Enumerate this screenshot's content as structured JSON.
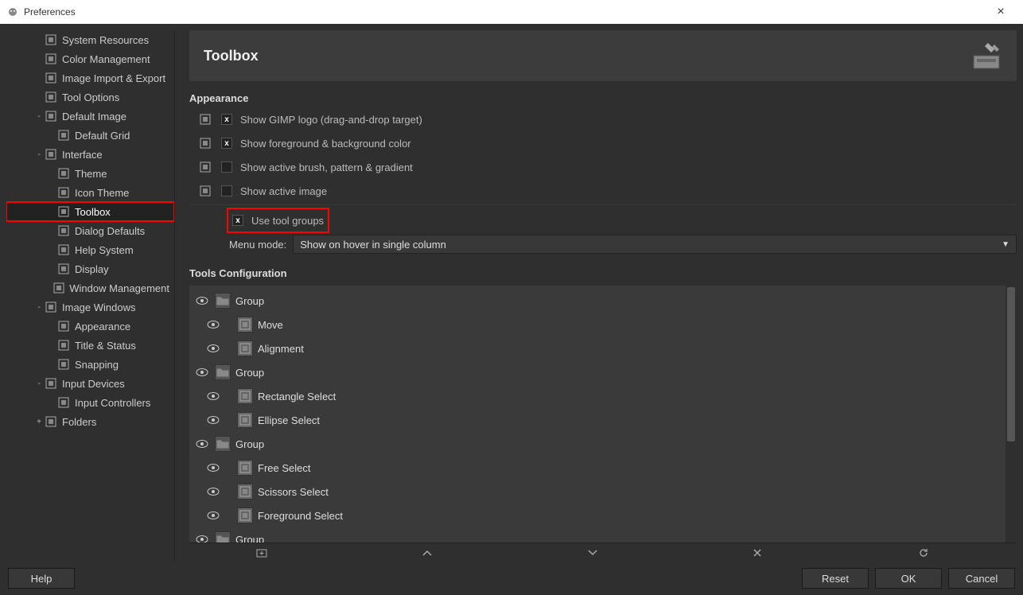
{
  "window": {
    "title": "Preferences"
  },
  "sidebar": {
    "items": [
      {
        "label": "System Resources",
        "indent": 1,
        "exp": "",
        "icon": "chip-icon"
      },
      {
        "label": "Color Management",
        "indent": 1,
        "exp": "",
        "icon": "color-mgmt-icon"
      },
      {
        "label": "Image Import & Export",
        "indent": 1,
        "exp": "",
        "icon": "import-export-icon"
      },
      {
        "label": "Tool Options",
        "indent": 1,
        "exp": "",
        "icon": "tool-options-icon"
      },
      {
        "label": "Default Image",
        "indent": 1,
        "exp": "-",
        "icon": "default-image-icon"
      },
      {
        "label": "Default Grid",
        "indent": 2,
        "exp": "",
        "icon": "grid-icon"
      },
      {
        "label": "Interface",
        "indent": 1,
        "exp": "-",
        "icon": "interface-icon"
      },
      {
        "label": "Theme",
        "indent": 2,
        "exp": "",
        "icon": "theme-icon"
      },
      {
        "label": "Icon Theme",
        "indent": 2,
        "exp": "",
        "icon": "icon-theme-icon"
      },
      {
        "label": "Toolbox",
        "indent": 2,
        "exp": "",
        "icon": "toolbox-tree-icon",
        "selected": true,
        "highlighted": true
      },
      {
        "label": "Dialog Defaults",
        "indent": 2,
        "exp": "",
        "icon": "dialog-defaults-icon"
      },
      {
        "label": "Help System",
        "indent": 2,
        "exp": "",
        "icon": "help-system-icon"
      },
      {
        "label": "Display",
        "indent": 2,
        "exp": "",
        "icon": "display-icon"
      },
      {
        "label": "Window Management",
        "indent": 2,
        "exp": "",
        "icon": "window-mgmt-icon"
      },
      {
        "label": "Image Windows",
        "indent": 1,
        "exp": "-",
        "icon": "image-windows-icon"
      },
      {
        "label": "Appearance",
        "indent": 2,
        "exp": "",
        "icon": "appearance-icon"
      },
      {
        "label": "Title & Status",
        "indent": 2,
        "exp": "",
        "icon": "title-status-icon"
      },
      {
        "label": "Snapping",
        "indent": 2,
        "exp": "",
        "icon": "snapping-icon"
      },
      {
        "label": "Input Devices",
        "indent": 1,
        "exp": "-",
        "icon": "input-devices-icon"
      },
      {
        "label": "Input Controllers",
        "indent": 2,
        "exp": "",
        "icon": "input-controllers-icon"
      },
      {
        "label": "Folders",
        "indent": 1,
        "exp": "+",
        "icon": "folders-icon"
      }
    ]
  },
  "header": {
    "title": "Toolbox"
  },
  "appearance": {
    "title": "Appearance",
    "options": [
      {
        "label": "Show GIMP logo (drag-and-drop target)",
        "checked": true,
        "icon": "gimp-logo-icon"
      },
      {
        "label": "Show foreground & background color",
        "checked": true,
        "icon": "fgbg-icon"
      },
      {
        "label": "Show active brush, pattern & gradient",
        "checked": false,
        "icon": "brush-icon"
      },
      {
        "label": "Show active image",
        "checked": false,
        "icon": "active-image-icon"
      }
    ],
    "tool_groups": {
      "label": "Use tool groups",
      "checked": true
    },
    "menu_mode": {
      "label": "Menu mode:",
      "value": "Show on hover in single column"
    }
  },
  "tools_config": {
    "title": "Tools Configuration",
    "rows": [
      {
        "type": "group",
        "label": "Group",
        "visible": true
      },
      {
        "type": "tool",
        "label": "Move",
        "visible": true,
        "icon": "move-tool-icon"
      },
      {
        "type": "tool",
        "label": "Alignment",
        "visible": true,
        "icon": "alignment-tool-icon"
      },
      {
        "type": "group",
        "label": "Group",
        "visible": true
      },
      {
        "type": "tool",
        "label": "Rectangle Select",
        "visible": true,
        "icon": "rect-select-icon"
      },
      {
        "type": "tool",
        "label": "Ellipse Select",
        "visible": true,
        "icon": "ellipse-select-icon"
      },
      {
        "type": "group",
        "label": "Group",
        "visible": true
      },
      {
        "type": "tool",
        "label": "Free Select",
        "visible": true,
        "icon": "free-select-icon"
      },
      {
        "type": "tool",
        "label": "Scissors Select",
        "visible": true,
        "icon": "scissors-select-icon"
      },
      {
        "type": "tool",
        "label": "Foreground Select",
        "visible": true,
        "icon": "foreground-select-icon"
      },
      {
        "type": "group",
        "label": "Group",
        "visible": true
      }
    ],
    "toolbar": {
      "add": "add",
      "up": "up",
      "down": "down",
      "delete": "delete",
      "reset": "reset"
    }
  },
  "footer": {
    "help": "Help",
    "reset": "Reset",
    "ok": "OK",
    "cancel": "Cancel"
  }
}
